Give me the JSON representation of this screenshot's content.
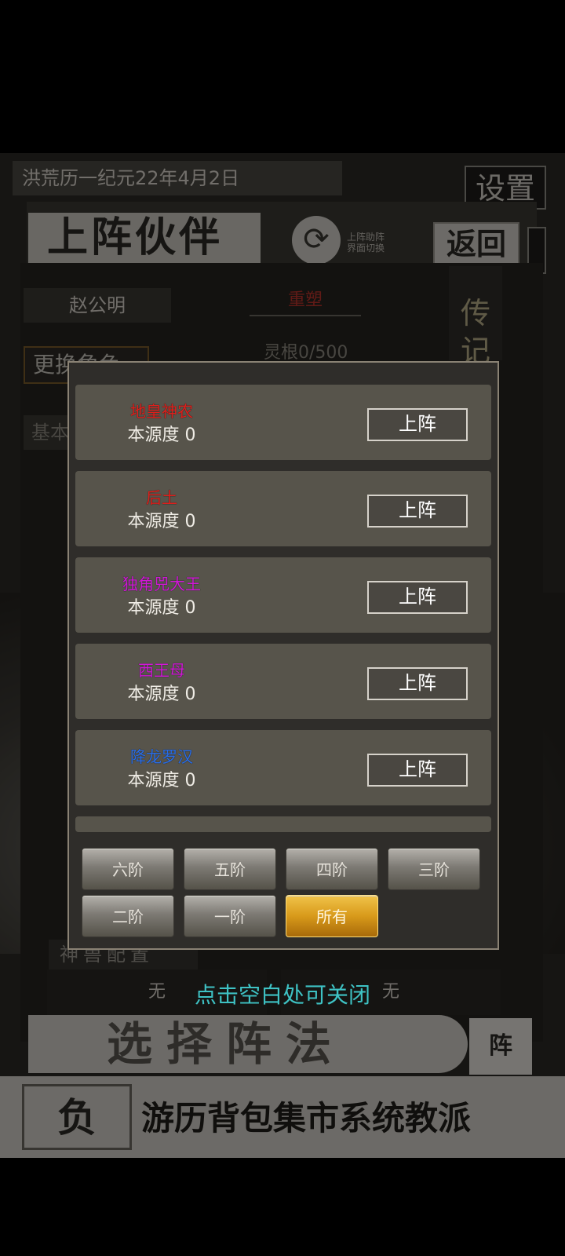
{
  "status": {
    "date": "洪荒历一纪元22年4月2日",
    "settings_label": "设置"
  },
  "partner": {
    "title": "上阵伙伴",
    "switch_text": "上阵助阵\n界面切换",
    "back_label": "返回",
    "tabs": {
      "name": "赵公明",
      "active": "重塑",
      "biography": "传记"
    },
    "spirit": "灵根0/500",
    "change_btn": "更换角色",
    "basic_label": "基本"
  },
  "beast": {
    "label": "神兽配置",
    "slot1": "无",
    "slot2": "无"
  },
  "hint": "点击空白处可关闭",
  "formation": {
    "label": "选择阵法",
    "btn": "阵"
  },
  "bottom_nav": {
    "left": "负",
    "items": "游历背包集市系统教派"
  },
  "modal": {
    "deploy_label": "上阵",
    "items": [
      {
        "name": "地皇神农",
        "name_color": "#e0201c",
        "source": "本源度 0"
      },
      {
        "name": "后土",
        "name_color": "#e0201c",
        "source": "本源度 0"
      },
      {
        "name": "独角兕大王",
        "name_color": "#d01ad6",
        "source": "本源度 0"
      },
      {
        "name": "西王母",
        "name_color": "#d01ad6",
        "source": "本源度 0"
      },
      {
        "name": "降龙罗汉",
        "name_color": "#2a6ee8",
        "source": "本源度 0"
      }
    ],
    "tiers": [
      "六阶",
      "五阶",
      "四阶",
      "三阶",
      "二阶",
      "一阶",
      "所有"
    ],
    "selected_tier": "所有"
  }
}
